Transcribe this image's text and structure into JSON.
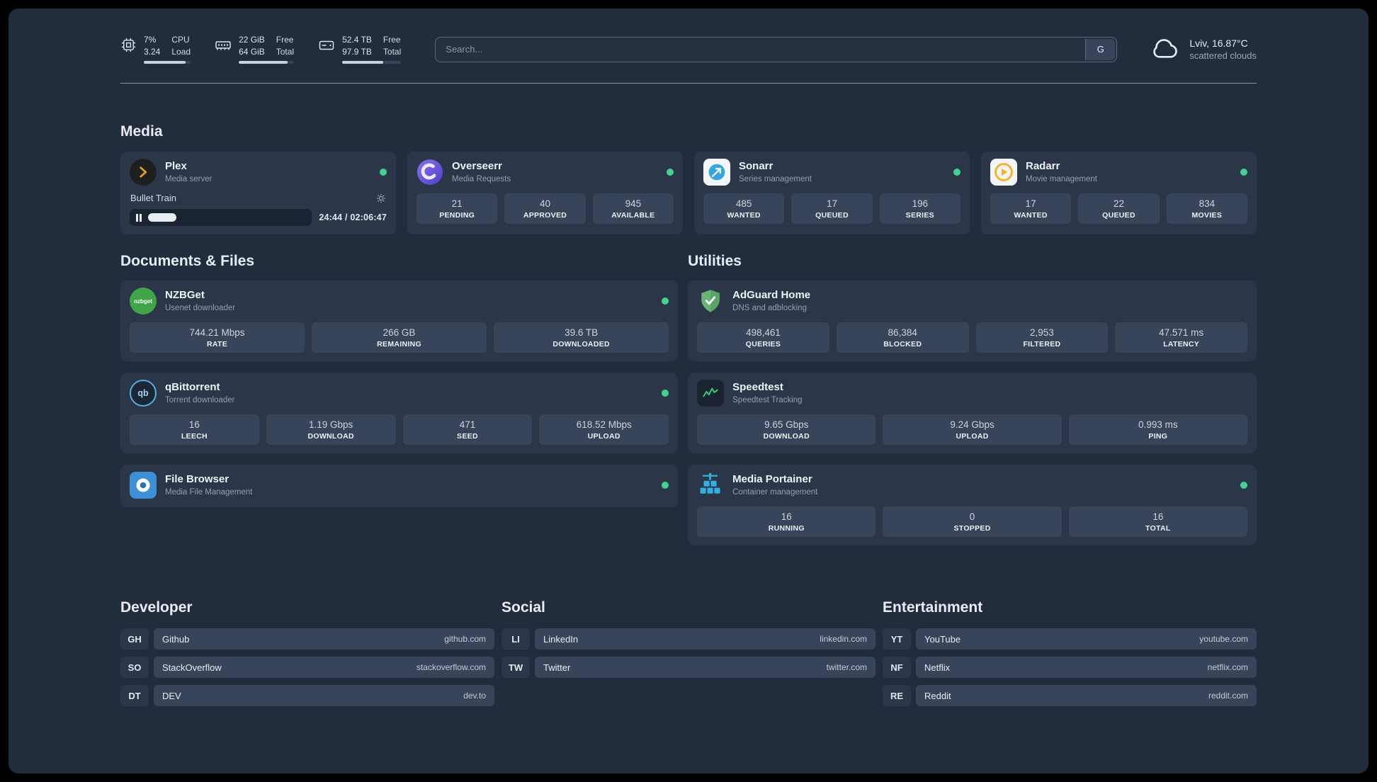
{
  "topbar": {
    "metrics": [
      {
        "id": "cpu",
        "values": [
          "7%",
          "3.24"
        ],
        "labels": [
          "CPU",
          "Load"
        ],
        "bar_pct": 90
      },
      {
        "id": "ram",
        "values": [
          "22 GiB",
          "64 GiB"
        ],
        "labels": [
          "Free",
          "Total"
        ],
        "bar_pct": 88
      },
      {
        "id": "disk",
        "values": [
          "52.4 TB",
          "97.9 TB"
        ],
        "labels": [
          "Free",
          "Total"
        ],
        "bar_pct": 70
      }
    ],
    "search": {
      "placeholder": "Search...",
      "button_label": "G"
    },
    "weather": {
      "location": "Lviv, 16.87°C",
      "condition": "scattered clouds"
    }
  },
  "media": {
    "heading": "Media",
    "plex": {
      "title": "Plex",
      "subtitle": "Media server",
      "now_playing": "Bullet Train",
      "time": "24:44 / 02:06:47"
    },
    "overseerr": {
      "title": "Overseerr",
      "subtitle": "Media Requests",
      "stats": [
        {
          "value": "21",
          "label": "PENDING"
        },
        {
          "value": "40",
          "label": "APPROVED"
        },
        {
          "value": "945",
          "label": "AVAILABLE"
        }
      ]
    },
    "sonarr": {
      "title": "Sonarr",
      "subtitle": "Series management",
      "stats": [
        {
          "value": "485",
          "label": "WANTED"
        },
        {
          "value": "17",
          "label": "QUEUED"
        },
        {
          "value": "196",
          "label": "SERIES"
        }
      ]
    },
    "radarr": {
      "title": "Radarr",
      "subtitle": "Movie management",
      "stats": [
        {
          "value": "17",
          "label": "WANTED"
        },
        {
          "value": "22",
          "label": "QUEUED"
        },
        {
          "value": "834",
          "label": "MOVIES"
        }
      ]
    }
  },
  "documents": {
    "heading": "Documents & Files",
    "nzbget": {
      "title": "NZBGet",
      "subtitle": "Usenet downloader",
      "icon_text": "nzbget",
      "stats": [
        {
          "value": "744.21 Mbps",
          "label": "RATE"
        },
        {
          "value": "266 GB",
          "label": "REMAINING"
        },
        {
          "value": "39.6 TB",
          "label": "DOWNLOADED"
        }
      ]
    },
    "qbittorrent": {
      "title": "qBittorrent",
      "subtitle": "Torrent downloader",
      "icon_text": "qb",
      "stats": [
        {
          "value": "16",
          "label": "LEECH"
        },
        {
          "value": "1.19 Gbps",
          "label": "DOWNLOAD"
        },
        {
          "value": "471",
          "label": "SEED"
        },
        {
          "value": "618.52 Mbps",
          "label": "UPLOAD"
        }
      ]
    },
    "filebrowser": {
      "title": "File Browser",
      "subtitle": "Media File Management"
    }
  },
  "utilities": {
    "heading": "Utilities",
    "adguard": {
      "title": "AdGuard Home",
      "subtitle": "DNS and adblocking",
      "stats": [
        {
          "value": "498,461",
          "label": "QUERIES"
        },
        {
          "value": "86,384",
          "label": "BLOCKED"
        },
        {
          "value": "2,953",
          "label": "FILTERED"
        },
        {
          "value": "47.571 ms",
          "label": "LATENCY"
        }
      ]
    },
    "speedtest": {
      "title": "Speedtest",
      "subtitle": "Speedtest Tracking",
      "stats": [
        {
          "value": "9.65 Gbps",
          "label": "DOWNLOAD"
        },
        {
          "value": "9.24 Gbps",
          "label": "UPLOAD"
        },
        {
          "value": "0.993 ms",
          "label": "PING"
        }
      ]
    },
    "portainer": {
      "title": "Media Portainer",
      "subtitle": "Container management",
      "stats": [
        {
          "value": "16",
          "label": "RUNNING"
        },
        {
          "value": "0",
          "label": "STOPPED"
        },
        {
          "value": "16",
          "label": "TOTAL"
        }
      ]
    }
  },
  "bookmarks": {
    "developer": {
      "heading": "Developer",
      "items": [
        {
          "abbr": "GH",
          "name": "Github",
          "url": "github.com"
        },
        {
          "abbr": "SO",
          "name": "StackOverflow",
          "url": "stackoverflow.com"
        },
        {
          "abbr": "DT",
          "name": "DEV",
          "url": "dev.to"
        }
      ]
    },
    "social": {
      "heading": "Social",
      "items": [
        {
          "abbr": "LI",
          "name": "LinkedIn",
          "url": "linkedin.com"
        },
        {
          "abbr": "TW",
          "name": "Twitter",
          "url": "twitter.com"
        }
      ]
    },
    "entertainment": {
      "heading": "Entertainment",
      "items": [
        {
          "abbr": "YT",
          "name": "YouTube",
          "url": "youtube.com"
        },
        {
          "abbr": "NF",
          "name": "Netflix",
          "url": "netflix.com"
        },
        {
          "abbr": "RE",
          "name": "Reddit",
          "url": "reddit.com"
        }
      ]
    }
  },
  "colors": {
    "status_online": "#3dd68c",
    "plex_accent": "#e5a00d",
    "background": "#212c3d",
    "card": "#2b3749",
    "tile": "#38445a"
  }
}
